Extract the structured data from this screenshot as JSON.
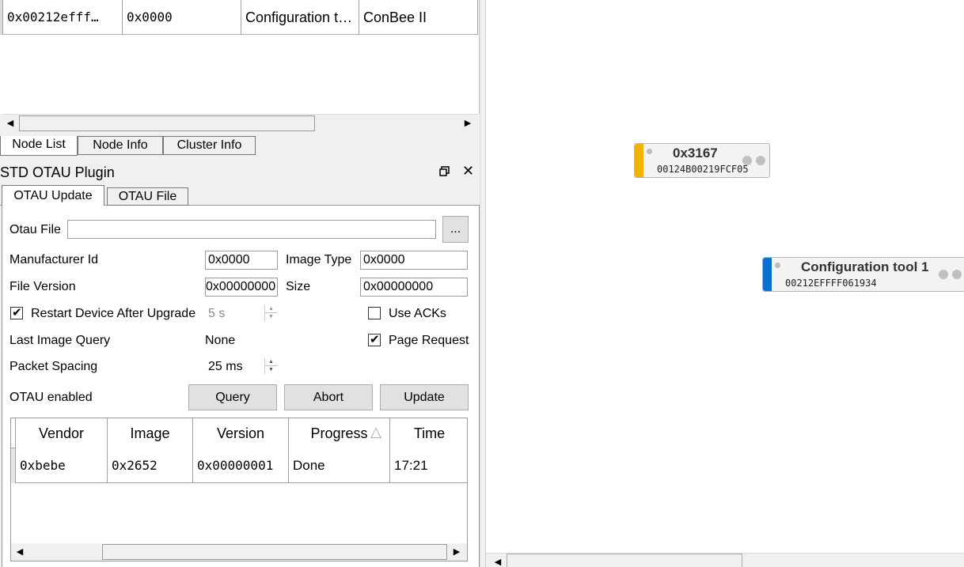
{
  "node_list": {
    "row": {
      "mac": "0x00212efff…",
      "nwk": "0x0000",
      "name": "Configuration t…",
      "type": "ConBee II"
    }
  },
  "bottom_tabs": [
    "Node List",
    "Node Info",
    "Cluster Info"
  ],
  "plugin": {
    "title": "STD OTAU Plugin",
    "tabs": [
      "OTAU Update",
      "OTAU File"
    ],
    "otau_file_label": "Otau File",
    "otau_file_value": "",
    "browse_label": "...",
    "manufacturer_id_label": "Manufacturer Id",
    "manufacturer_id_value": "0x0000",
    "image_type_label": "Image Type",
    "image_type_value": "0x0000",
    "file_version_label": "File Version",
    "file_version_value": "0x00000000",
    "size_label": "Size",
    "size_value": "0x00000000",
    "restart_label": "Restart Device After Upgrade",
    "restart_checked": true,
    "restart_delay": "5 s",
    "use_acks_label": "Use ACKs",
    "use_acks_checked": false,
    "last_image_query_label": "Last Image Query",
    "last_image_query_value": "None",
    "page_request_label": "Page Request",
    "page_request_checked": true,
    "packet_spacing_label": "Packet Spacing",
    "packet_spacing_value": "25 ms",
    "otau_enabled_label": "OTAU enabled",
    "query_label": "Query",
    "abort_label": "Abort",
    "update_label": "Update",
    "table": {
      "headers": [
        "Vendor",
        "Image",
        "Version",
        "Progress",
        "Time"
      ],
      "row": {
        "vendor": "0xbebe",
        "image": "0x2652",
        "version": "0x00000001",
        "progress": "Done",
        "time": "17:21"
      }
    }
  },
  "nodes": [
    {
      "title": "0x3167",
      "subtitle": "00124B00219FCF05",
      "color": "#f0b400"
    },
    {
      "title": "Configuration tool 1",
      "subtitle": "00212EFFFF061934",
      "color": "#0a6fd0"
    }
  ]
}
